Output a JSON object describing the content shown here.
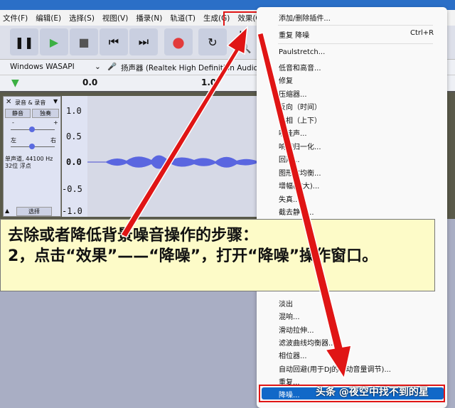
{
  "menubar": [
    "文件(F)",
    "编辑(E)",
    "选择(S)",
    "视图(V)",
    "播录(N)",
    "轨道(T)",
    "生成(G)",
    "效果(C)"
  ],
  "device": {
    "host": "Windows WASAPI",
    "output": "扬声器 (Realtek High Definition Audio) ("
  },
  "timeline": {
    "t0": "0.0",
    "t1": "1.0"
  },
  "track": {
    "name": "录音 & 录音",
    "mute": "静音",
    "solo": "独奏",
    "gain_min": "-",
    "gain_max": "+",
    "left": "左",
    "right": "右",
    "info1": "单声道, 44100 Hz",
    "info2": "32位 浮点",
    "select": "选择",
    "scale": [
      "1.0",
      "0.5",
      "0.0",
      "-0.5",
      "-1.0"
    ]
  },
  "menu": {
    "top": [
      {
        "label": "添加/删除插件..."
      },
      {
        "label": "重复 降噪",
        "shortcut": "Ctrl+R"
      }
    ],
    "items": [
      "Paulstretch...",
      "低音和高音...",
      "修复",
      "压缩器...",
      "反向（时间）",
      "反相（上下）",
      "哇哇声...",
      "响度归一化...",
      "回声...",
      "图形化均衡...",
      "增幅(放大)...",
      "失真...",
      "截去静音..."
    ],
    "bottom": [
      "淡出",
      "混响...",
      "滑动拉伸...",
      "滤波曲线均衡器...",
      "相位器...",
      "自动回避(用于DJ的自动音量调节)...",
      "重复..."
    ],
    "selected": "降噪..."
  },
  "callout": {
    "line1": "去除或者降低背景噪音操作的步骤：",
    "line2": "2，点击“效果”——“降噪”，打开“降噪”操作窗口。"
  },
  "watermark": "头条 @夜空中找不到的星"
}
